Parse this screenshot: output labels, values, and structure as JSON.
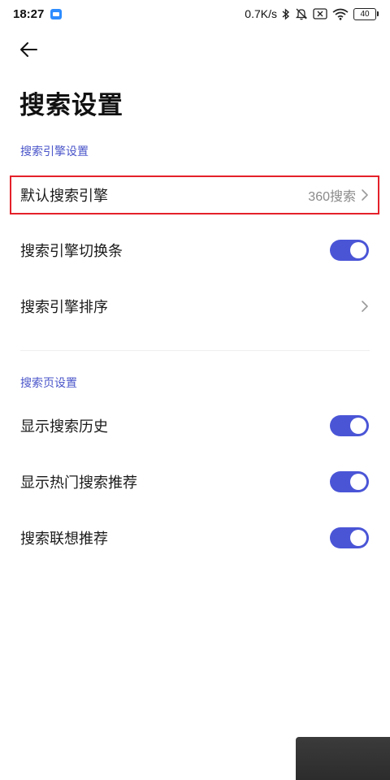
{
  "status_bar": {
    "time": "18:27",
    "net_speed": "0.7K/s",
    "battery": "40",
    "icons": [
      "app-notification-icon",
      "bluetooth-icon",
      "mute-bell-icon",
      "no-sim-icon",
      "wifi-icon",
      "battery-icon"
    ]
  },
  "header": {
    "back_icon": "arrow-left-icon",
    "title": "搜索设置"
  },
  "sections": {
    "engine": {
      "title": "搜索引擎设置",
      "default_engine": {
        "label": "默认搜索引擎",
        "value": "360搜索"
      },
      "switch_bar": {
        "label": "搜索引擎切换条",
        "enabled": true
      },
      "sort": {
        "label": "搜索引擎排序"
      }
    },
    "search_page": {
      "title": "搜索页设置",
      "show_history": {
        "label": "显示搜索历史",
        "enabled": true
      },
      "show_hot": {
        "label": "显示热门搜索推荐",
        "enabled": true
      },
      "suggestions": {
        "label": "搜索联想推荐",
        "enabled": true
      }
    }
  },
  "colors": {
    "accent": "#4a55d6",
    "section_header": "#4a55c9",
    "highlight": "#e4212a",
    "value_text": "#8a8a8a"
  }
}
